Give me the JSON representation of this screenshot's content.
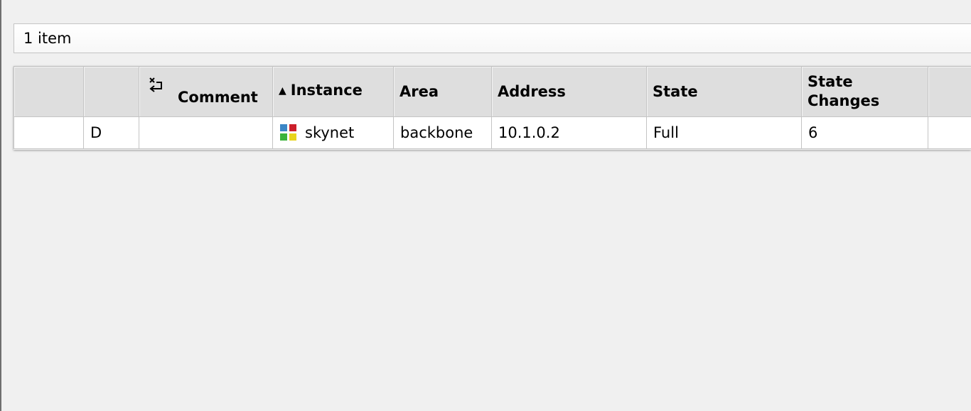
{
  "status_bar": {
    "item_count": "1 item"
  },
  "table": {
    "headers": {
      "col1": "",
      "col2": "",
      "comment": "Comment",
      "instance": "Instance",
      "instance_sort": "▲",
      "area": "Area",
      "address": "Address",
      "state": "State",
      "state_changes": "State Changes",
      "col9": ""
    },
    "rows": [
      {
        "col1": "",
        "flag": "D",
        "comment": "",
        "instance": "skynet",
        "instance_icon": "instance-icon",
        "area": "backbone",
        "address": "10.1.0.2",
        "state": "Full",
        "state_changes": "6",
        "col9": ""
      }
    ]
  },
  "colors": {
    "background": "#f0f0f0",
    "header_bg": "#dedede",
    "border": "#c4c4c4",
    "icon_blue": "#3b86c6",
    "icon_red": "#cc1f2b",
    "icon_green": "#3bb33b",
    "icon_yellow": "#e8d41c"
  }
}
